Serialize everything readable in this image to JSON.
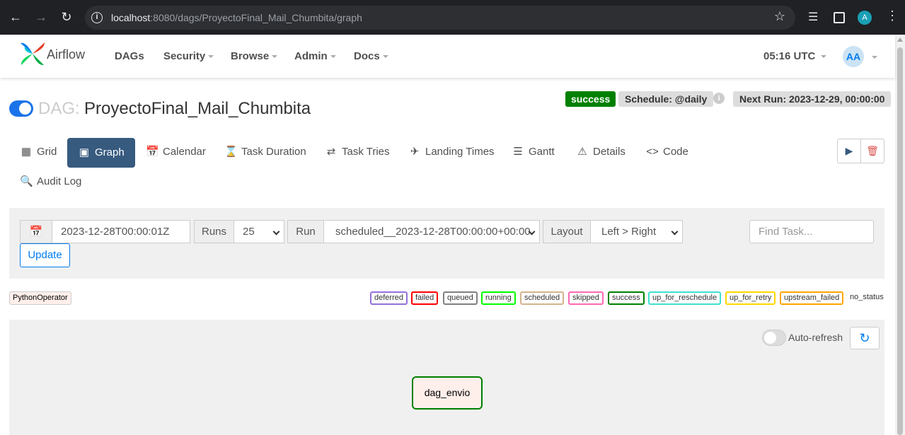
{
  "browser": {
    "url_host": "localhost",
    "url_path": ":8080/dags/ProyectoFinal_Mail_Chumbita/graph",
    "profile_initial": "A"
  },
  "navbar": {
    "brand": "Airflow",
    "menu": [
      "DAGs",
      "Security",
      "Browse",
      "Admin",
      "Docs"
    ],
    "clock": "05:16 UTC",
    "user_initials": "AA"
  },
  "dag": {
    "prefix": "DAG:",
    "name": "ProyectoFinal_Mail_Chumbita",
    "paused": false,
    "status": "success",
    "schedule": "Schedule: @daily",
    "next_run": "Next Run: 2023-12-29, 00:00:00"
  },
  "tabs": [
    {
      "label": "Grid",
      "icon": "grid-icon"
    },
    {
      "label": "Graph",
      "icon": "graph-icon"
    },
    {
      "label": "Calendar",
      "icon": "calendar-icon"
    },
    {
      "label": "Task Duration",
      "icon": "hourglass-icon"
    },
    {
      "label": "Task Tries",
      "icon": "retry-icon"
    },
    {
      "label": "Landing Times",
      "icon": "landing-icon"
    },
    {
      "label": "Gantt",
      "icon": "gantt-icon"
    },
    {
      "label": "Details",
      "icon": "warning-icon"
    },
    {
      "label": "Code",
      "icon": "code-icon"
    },
    {
      "label": "Audit Log",
      "icon": "audit-icon"
    }
  ],
  "filters": {
    "date_value": "2023-12-28T00:00:01Z",
    "runs_label": "Runs",
    "runs_value": "25",
    "run_label": "Run",
    "run_value": "scheduled__2023-12-28T00:00:00+00:00",
    "layout_label": "Layout",
    "layout_value": "Left > Right",
    "find_placeholder": "Find Task...",
    "update_label": "Update"
  },
  "operator_chip": "PythonOperator",
  "legend": [
    {
      "label": "deferred",
      "color": "#9370db"
    },
    {
      "label": "failed",
      "color": "#ff0000"
    },
    {
      "label": "queued",
      "color": "#808080"
    },
    {
      "label": "running",
      "color": "#00ff00"
    },
    {
      "label": "scheduled",
      "color": "#d2b48c"
    },
    {
      "label": "skipped",
      "color": "#ff69b4"
    },
    {
      "label": "success",
      "color": "#008000"
    },
    {
      "label": "up_for_reschedule",
      "color": "#40e0d0"
    },
    {
      "label": "up_for_retry",
      "color": "#ffd700"
    },
    {
      "label": "upstream_failed",
      "color": "#ffa500"
    }
  ],
  "no_status_label": "no_status",
  "graph": {
    "auto_refresh_label": "Auto-refresh",
    "node_label": "dag_envio"
  }
}
